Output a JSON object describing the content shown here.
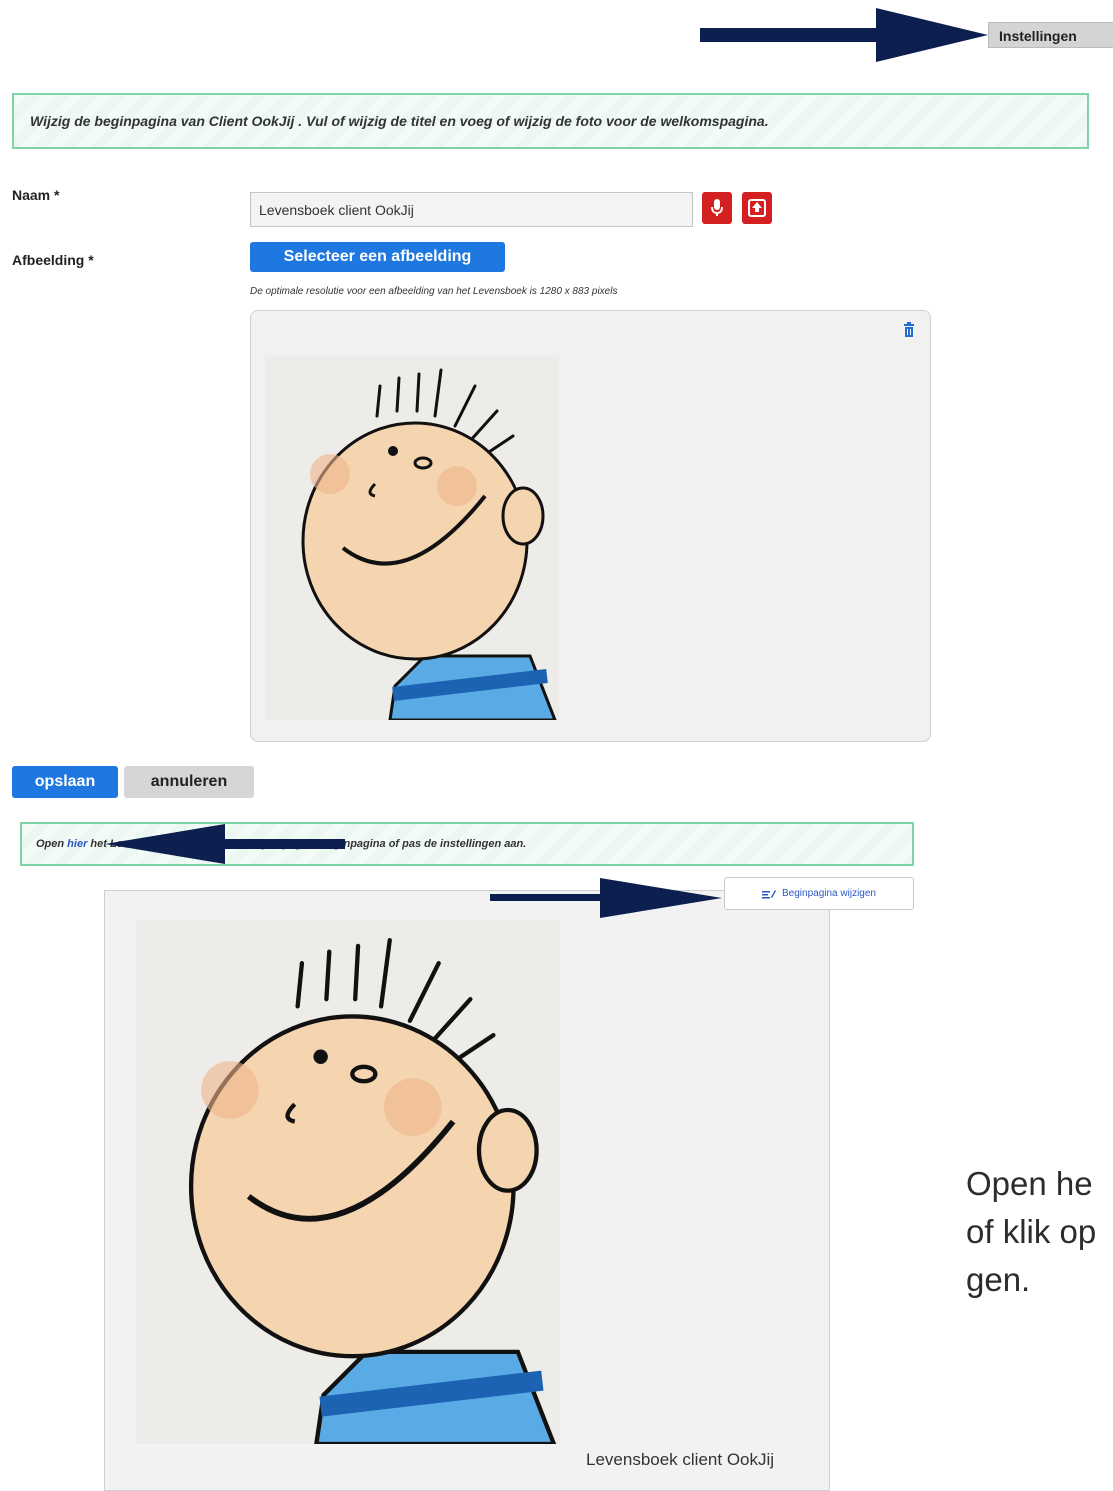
{
  "header": {
    "settings_label": "Instellingen"
  },
  "banner_top": {
    "text": "Wijzig de beginpagina van Client OokJij . Vul of wijzig de titel en voeg of wijzig de foto voor de welkomspagina."
  },
  "form": {
    "name_label": "Naam *",
    "name_value": "Levensboek client OokJij",
    "image_label": "Afbeelding *",
    "select_image_label": "Selecteer een afbeelding",
    "resolution_hint": "De optimale resolutie voor een afbeelding van het Levensboek is 1280 x 883 pixels",
    "save_label": "opslaan",
    "cancel_label": "annuleren"
  },
  "banner_bottom": {
    "prefix": "Open ",
    "link": "hier",
    "suffix": " het Levensboek van Client OokJij, wijzig de beginpagina of pas de instellingen aan."
  },
  "home": {
    "edit_label": "Beginpagina wijzigen",
    "caption": "Levensboek client OokJij"
  },
  "side_text": "Open he\nof klik op\ngen.",
  "colors": {
    "primary_blue": "#1e78e0",
    "danger_red": "#d42020",
    "arrow_navy": "#0d1f4f",
    "banner_border": "#7ed4a6"
  },
  "icons": [
    "microphone-icon",
    "upload-icon",
    "trash-icon",
    "edit-icon",
    "arrow-icon"
  ]
}
